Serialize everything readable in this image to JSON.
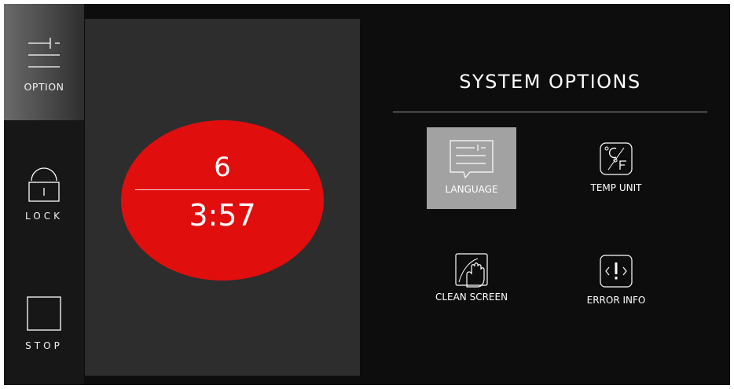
{
  "sidebar": {
    "option_label": "OPTION",
    "lock_label": "LOCK",
    "stop_label": "STOP"
  },
  "timer": {
    "top_value": "6",
    "time_value": "3:57",
    "circle_color": "#e10e0e"
  },
  "options": {
    "title": "SYSTEM OPTIONS",
    "items": [
      {
        "label": "LANGUAGE",
        "icon": "language-icon",
        "selected": true
      },
      {
        "label": "TEMP UNIT",
        "icon": "temp-unit-icon",
        "selected": false
      },
      {
        "label": "CLEAN SCREEN",
        "icon": "clean-screen-icon",
        "selected": false
      },
      {
        "label": "ERROR INFO",
        "icon": "error-info-icon",
        "selected": false
      }
    ],
    "selected_color": "#a2a2a2"
  }
}
